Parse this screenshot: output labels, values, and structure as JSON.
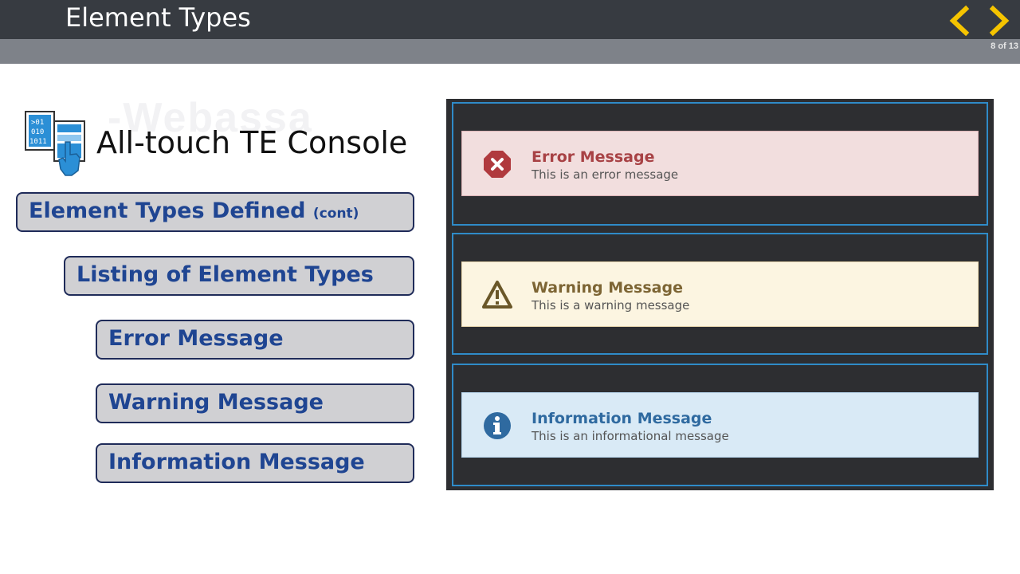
{
  "header": {
    "title": "Element Types",
    "page_counter": "8 of 13",
    "prev_icon": "chevron-left-icon",
    "next_icon": "chevron-right-icon",
    "accent_color": "#f5c400"
  },
  "sidebar": {
    "icon": "console-touch-icon",
    "console_title": "All-touch TE Console",
    "items": [
      {
        "label": "Element Types Defined",
        "suffix": "(cont)"
      },
      {
        "label": "Listing of Element Types"
      },
      {
        "label": "Error Message"
      },
      {
        "label": "Warning Message"
      },
      {
        "label": "Information Message"
      }
    ]
  },
  "alerts": {
    "error": {
      "title": "Error Message",
      "text": "This is an error message",
      "icon": "error-icon",
      "color": "#b03a3e"
    },
    "warning": {
      "title": "Warning Message",
      "text": "This is a warning message",
      "icon": "warning-icon",
      "color": "#6a5728"
    },
    "info": {
      "title": "Information Message",
      "text": "This is an informational message",
      "icon": "info-icon",
      "color": "#2f6aa0"
    }
  }
}
